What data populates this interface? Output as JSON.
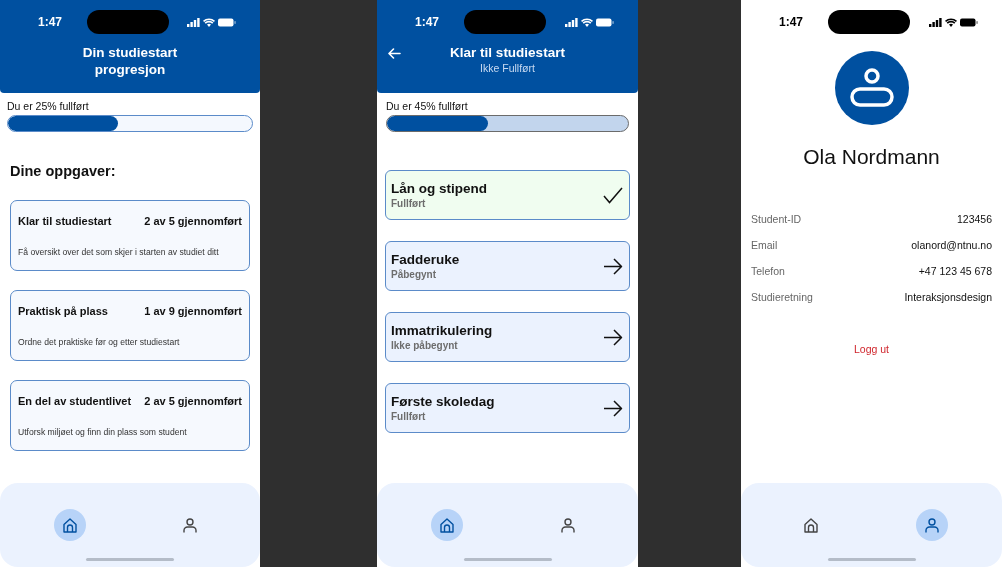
{
  "screens": [
    {
      "kind": "overview",
      "status_bar": {
        "time": "1:47"
      },
      "header": {
        "title": "Din studiestart progresjon"
      },
      "progress": {
        "label": "Du er 25% fullført",
        "level": 0.45
      },
      "section_title": "Dine oppgaver:",
      "tasks": [
        {
          "title": "Klar til studiestart",
          "count": "2 av 5 gjennomført",
          "description": "Få oversikt over det som skjer i starten av studiet ditt"
        },
        {
          "title": "Praktisk på plass",
          "count": "1 av 9 gjennomført",
          "description": "Ordne det praktiske før og etter studiestart"
        },
        {
          "title": "En del av studentlivet",
          "count": "2 av 5 gjennomført",
          "description": "Utforsk miljøet og finn din plass som student"
        }
      ],
      "nav": [
        {
          "kind": "home",
          "selected": true
        },
        {
          "kind": "profile",
          "selected": false
        }
      ]
    },
    {
      "kind": "detail",
      "status_bar": {
        "time": "1:47"
      },
      "header": {
        "title": "Klar til studiestart",
        "subtitle": "Ikke Fullført"
      },
      "progress": {
        "label": "Du er 45% fullført",
        "level": 0.42
      },
      "steps": [
        {
          "title": "Lån og stipend",
          "status": "Fullført",
          "completed": true
        },
        {
          "title": "Fadderuke",
          "status": "Påbegynt",
          "completed": false
        },
        {
          "title": "Immatrikulering",
          "status": "Ikke påbegynt",
          "completed": false
        },
        {
          "title": "Første skoledag",
          "status": "Fullført",
          "completed": false
        }
      ],
      "nav": [
        {
          "kind": "home",
          "selected": true
        },
        {
          "kind": "profile",
          "selected": false
        }
      ]
    },
    {
      "kind": "profile",
      "status_bar": {
        "time": "1:47"
      },
      "name": "Ola Nordmann",
      "fields": [
        {
          "label": "Student-ID",
          "value": "123456"
        },
        {
          "label": "Email",
          "value": "olanord@ntnu.no"
        },
        {
          "label": "Telefon",
          "value": "+47 123 45 678"
        },
        {
          "label": "Studieretning",
          "value": "Interaksjonsdesign"
        }
      ],
      "logout": "Logg ut",
      "nav": [
        {
          "kind": "home",
          "selected": false
        },
        {
          "kind": "profile",
          "selected": true
        }
      ]
    }
  ]
}
